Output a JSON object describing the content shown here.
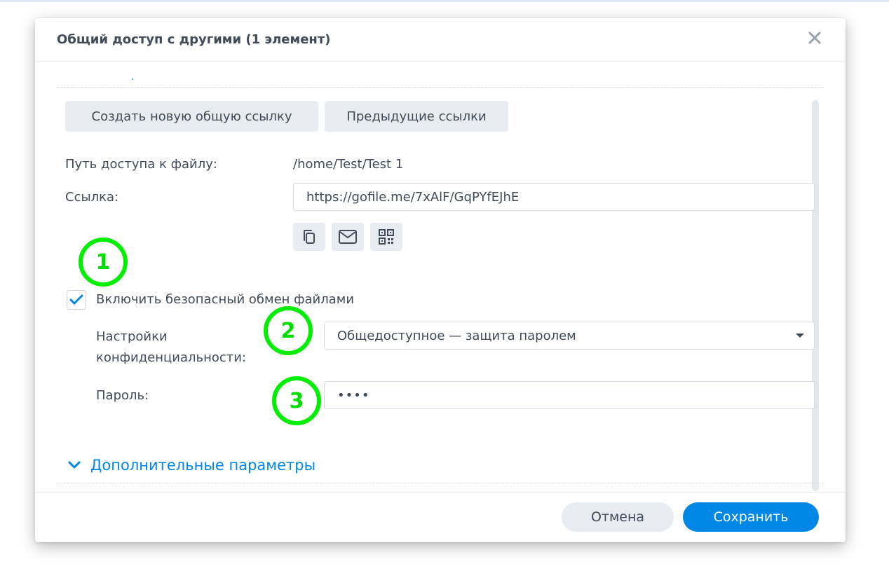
{
  "dialog": {
    "title": "Общий доступ с другими (1 элемент)",
    "close_icon": "close-icon"
  },
  "tabs": {
    "create_link": "Создать новую общую ссылку",
    "previous_links": "Предыдущие ссылки"
  },
  "file_path": {
    "label": "Путь доступа к файлу:",
    "value": "/home/Test/Test 1"
  },
  "link": {
    "label": "Ссылка:",
    "value": "https://gofile.me/7xAlF/GqPYfEJhE",
    "actions": [
      "copy-icon",
      "mail-icon",
      "qr-code-icon"
    ]
  },
  "secure_sharing": {
    "label": "Включить безопасный обмен файлами",
    "checked": true
  },
  "privacy": {
    "label_line1": "Настройки",
    "label_line2": "конфиденциальности:",
    "selected": "Общедоступное — защита паролем"
  },
  "password": {
    "label": "Пароль:",
    "masked": "••••"
  },
  "advanced": {
    "label": "Дополнительные параметры",
    "icon": "chevron-down-icon"
  },
  "footer": {
    "cancel": "Отмена",
    "save": "Сохранить"
  },
  "annotations": [
    "1",
    "2",
    "3"
  ],
  "colors": {
    "accent": "#0086e5",
    "text": "#414b58",
    "annotation": "#00ee00"
  }
}
